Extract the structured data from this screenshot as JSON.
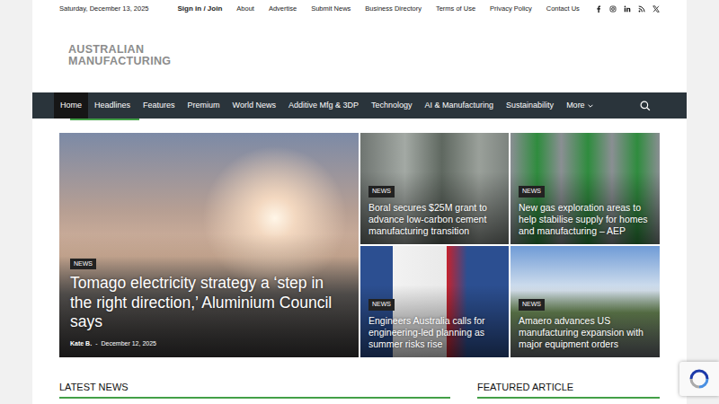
{
  "top_bar": {
    "date": "Saturday, December 13, 2025",
    "account_link": "Sign in / Join",
    "links": [
      "About",
      "Advertise",
      "Submit News",
      "Business Directory",
      "Terms of Use",
      "Privacy Policy",
      "Contact Us"
    ]
  },
  "logo": {
    "line1": "AUSTRALIAN",
    "line2": "MANUFACTURING"
  },
  "nav": {
    "items": [
      {
        "label": "Home",
        "selected": true
      },
      {
        "label": "Headlines",
        "selected": false
      },
      {
        "label": "Features",
        "selected": false
      },
      {
        "label": "Premium",
        "selected": false
      },
      {
        "label": "World News",
        "selected": false
      },
      {
        "label": "Additive Mfg & 3DP",
        "selected": false
      },
      {
        "label": "Technology",
        "selected": false
      },
      {
        "label": "AI & Manufacturing",
        "selected": false
      },
      {
        "label": "Sustainability",
        "selected": false
      },
      {
        "label": "More",
        "selected": false
      }
    ]
  },
  "hero": {
    "main": {
      "category": "NEWS",
      "title": "Tomago electricity strategy a ‘step in the right direction,’ Aluminium Council says",
      "author": "Kate B.",
      "separator": "-",
      "date": "December 12, 2025"
    },
    "tiles": [
      {
        "category": "NEWS",
        "title": "Boral secures $25M grant to advance low-carbon cement manufacturing transition"
      },
      {
        "category": "NEWS",
        "title": "New gas exploration areas to help stabilise supply for homes and manufacturing – AEP"
      },
      {
        "category": "NEWS",
        "title": "Engineers Australia calls for engineering-led planning as summer risks rise"
      },
      {
        "category": "NEWS",
        "title": "Amaero advances US manufacturing expansion with major equipment orders"
      }
    ]
  },
  "sections": [
    {
      "title": "LATEST NEWS"
    },
    {
      "title": "FEATURED ARTICLE"
    }
  ]
}
